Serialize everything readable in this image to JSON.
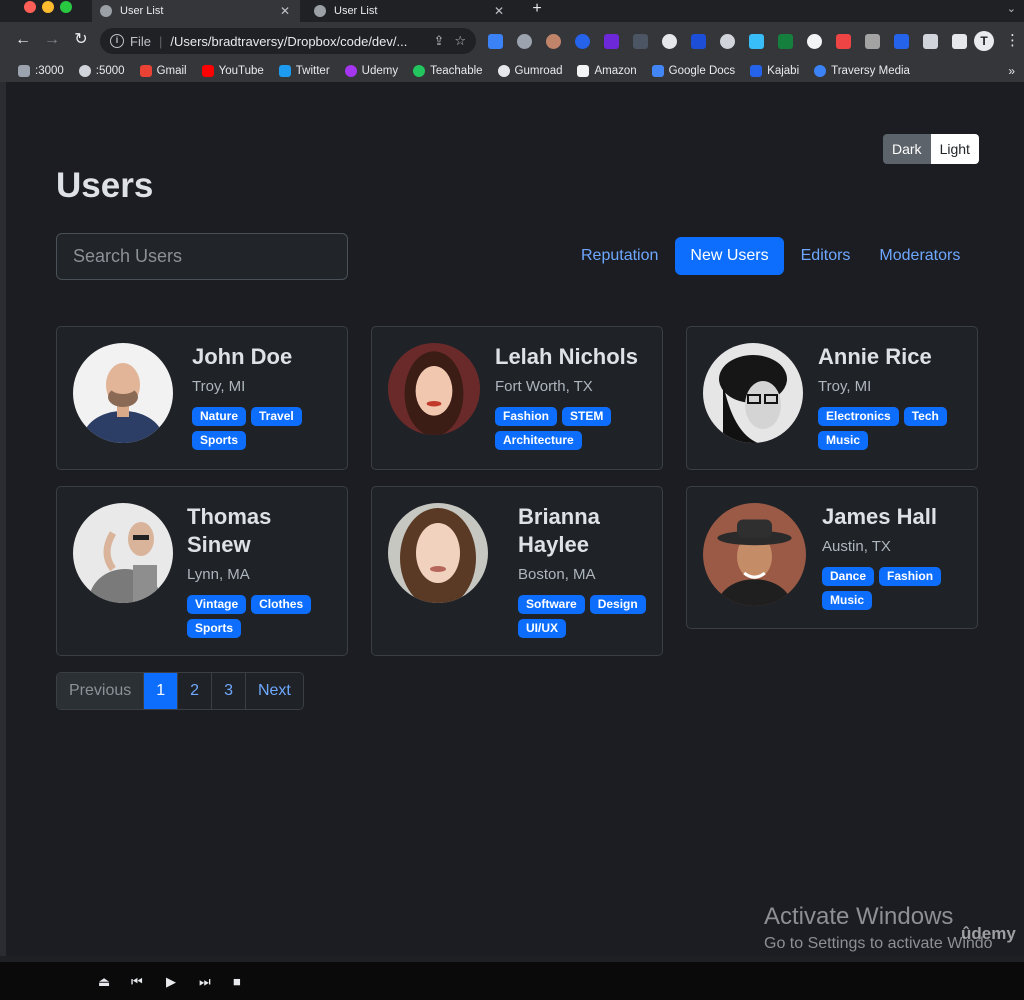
{
  "browser": {
    "tabs": [
      {
        "title": "User List",
        "active": true
      },
      {
        "title": "User List",
        "active": false
      }
    ],
    "address": {
      "scheme": "File",
      "url": "/Users/bradtraversy/Dropbox/code/dev/..."
    },
    "profile_initial": "T",
    "bookmarks": [
      ":3000",
      ":5000",
      "Gmail",
      "YouTube",
      "Twitter",
      "Udemy",
      "Teachable",
      "Gumroad",
      "Amazon",
      "Google Docs",
      "Kajabi",
      "Traversy Media"
    ]
  },
  "theme_toggle": {
    "dark": "Dark",
    "light": "Light"
  },
  "page": {
    "title": "Users",
    "search_placeholder": "Search Users"
  },
  "filters": [
    {
      "label": "Reputation",
      "active": false
    },
    {
      "label": "New Users",
      "active": true
    },
    {
      "label": "Editors",
      "active": false
    },
    {
      "label": "Moderators",
      "active": false
    }
  ],
  "users": [
    {
      "name": "John Doe",
      "location": "Troy, MI",
      "tags": [
        "Nature",
        "Travel",
        "Sports"
      ]
    },
    {
      "name": "Lelah Nichols",
      "location": "Fort Worth, TX",
      "tags": [
        "Fashion",
        "STEM",
        "Architecture"
      ]
    },
    {
      "name": "Annie Rice",
      "location": "Troy, MI",
      "tags": [
        "Electronics",
        "Tech",
        "Music"
      ]
    },
    {
      "name": "Thomas Sinew",
      "location": "Lynn, MA",
      "tags": [
        "Vintage",
        "Clothes",
        "Sports"
      ]
    },
    {
      "name": "Brianna Haylee",
      "location": "Boston, MA",
      "tags": [
        "Software",
        "Design",
        "UI/UX"
      ]
    },
    {
      "name": "James Hall",
      "location": "Austin, TX",
      "tags": [
        "Dance",
        "Fashion",
        "Music"
      ]
    }
  ],
  "pagination": {
    "previous": "Previous",
    "pages": [
      "1",
      "2",
      "3"
    ],
    "active_page": "1",
    "next": "Next"
  },
  "overlay": {
    "activate_title": "Activate Windows",
    "activate_subtitle": "Go to Settings to activate Windo",
    "watermark": "ûdemy"
  },
  "colors": {
    "primary": "#0d6efd",
    "link": "#6ea8fe",
    "background": "#1b1d22"
  }
}
